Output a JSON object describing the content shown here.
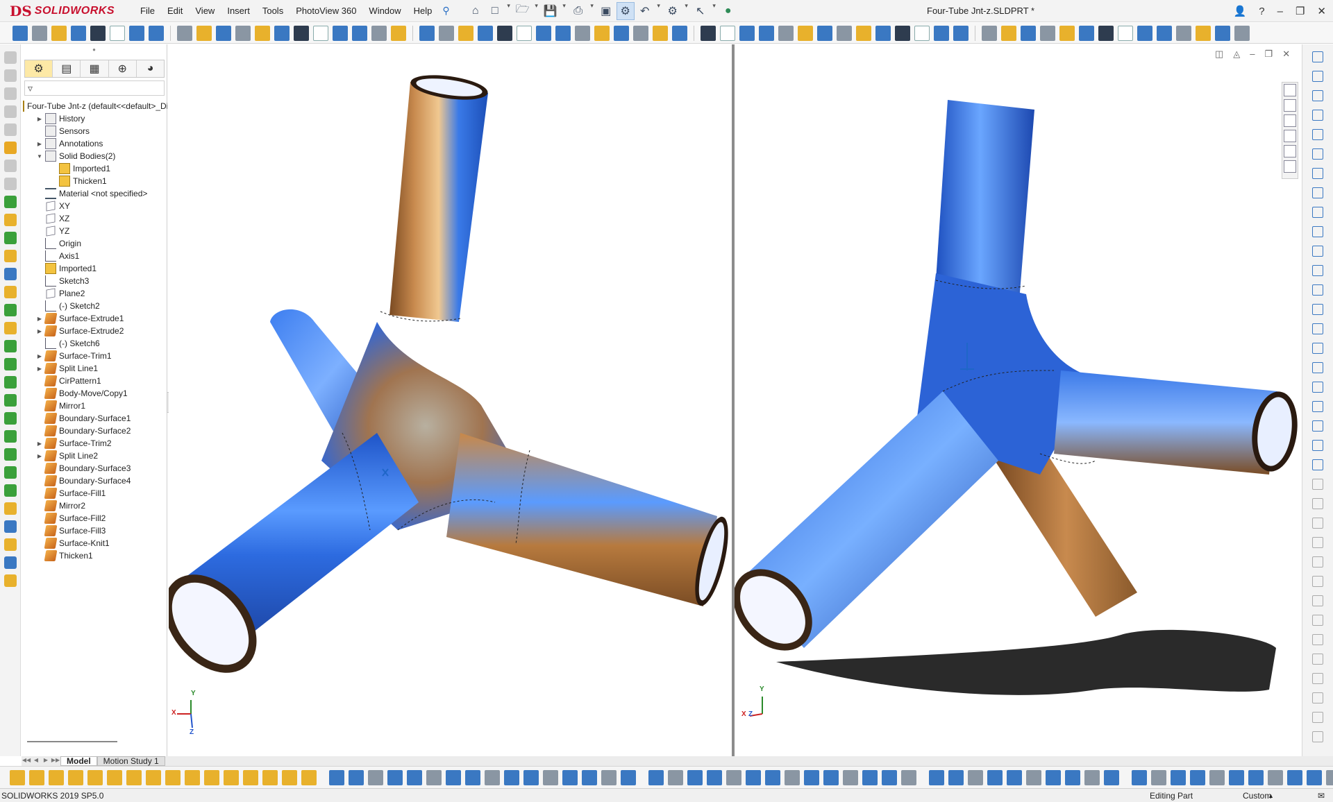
{
  "app": {
    "brand_mark": "DS",
    "brand_name": "SOLIDWORKS",
    "document_title": "Four-Tube Jnt-z.SLDPRT *"
  },
  "menu": [
    "File",
    "Edit",
    "View",
    "Insert",
    "Tools",
    "PhotoView 360",
    "Window",
    "Help"
  ],
  "window_controls": [
    "user-icon",
    "help-icon",
    "minimize-icon",
    "restore-icon",
    "close-icon"
  ],
  "feature_tree": {
    "panel_tabs": [
      "feature-manager-icon",
      "property-manager-icon",
      "configuration-manager-icon",
      "dimxpert-icon",
      "display-manager-icon"
    ],
    "nodes": [
      {
        "label": "Four-Tube Jnt-z  (default<<default>_Dis",
        "icon": "part-icon",
        "expandable": false,
        "indent": 0
      },
      {
        "label": "History",
        "icon": "folder-icon",
        "expandable": true,
        "indent": 1
      },
      {
        "label": "Sensors",
        "icon": "sensor-icon",
        "expandable": false,
        "indent": 1
      },
      {
        "label": "Annotations",
        "icon": "annotation-icon",
        "expandable": true,
        "indent": 1
      },
      {
        "label": "Solid Bodies(2)",
        "icon": "folder-icon",
        "expandable": true,
        "expanded": true,
        "indent": 1
      },
      {
        "label": "Imported1",
        "icon": "solid-body-icon",
        "expandable": false,
        "indent": 2
      },
      {
        "label": "Thicken1",
        "icon": "solid-body-icon",
        "expandable": false,
        "indent": 2
      },
      {
        "label": "Material <not specified>",
        "icon": "material-icon",
        "expandable": false,
        "indent": 1
      },
      {
        "label": "XY",
        "icon": "plane-icon",
        "expandable": false,
        "indent": 1
      },
      {
        "label": "XZ",
        "icon": "plane-icon",
        "expandable": false,
        "indent": 1
      },
      {
        "label": "YZ",
        "icon": "plane-icon",
        "expandable": false,
        "indent": 1
      },
      {
        "label": "Origin",
        "icon": "origin-icon",
        "expandable": false,
        "indent": 1
      },
      {
        "label": "Axis1",
        "icon": "axis-icon",
        "expandable": false,
        "indent": 1
      },
      {
        "label": "Imported1",
        "icon": "imported-feature-icon",
        "expandable": false,
        "indent": 1
      },
      {
        "label": "Sketch3",
        "icon": "sketch-icon",
        "expandable": false,
        "indent": 1
      },
      {
        "label": "Plane2",
        "icon": "plane-icon",
        "expandable": false,
        "indent": 1
      },
      {
        "label": "(-) Sketch2",
        "icon": "sketch-icon",
        "expandable": false,
        "indent": 1
      },
      {
        "label": "Surface-Extrude1",
        "icon": "surface-feature-icon",
        "expandable": true,
        "indent": 1
      },
      {
        "label": "Surface-Extrude2",
        "icon": "surface-feature-icon",
        "expandable": true,
        "indent": 1
      },
      {
        "label": "(-) Sketch6",
        "icon": "sketch-icon",
        "expandable": false,
        "indent": 1
      },
      {
        "label": "Surface-Trim1",
        "icon": "surface-feature-icon",
        "expandable": true,
        "indent": 1
      },
      {
        "label": "Split Line1",
        "icon": "split-line-icon",
        "expandable": true,
        "indent": 1
      },
      {
        "label": "CirPattern1",
        "icon": "pattern-icon",
        "expandable": false,
        "indent": 1
      },
      {
        "label": "Body-Move/Copy1",
        "icon": "move-body-icon",
        "expandable": false,
        "indent": 1
      },
      {
        "label": "Mirror1",
        "icon": "mirror-icon",
        "expandable": false,
        "indent": 1
      },
      {
        "label": "Boundary-Surface1",
        "icon": "surface-feature-icon",
        "expandable": false,
        "indent": 1
      },
      {
        "label": "Boundary-Surface2",
        "icon": "surface-feature-icon",
        "expandable": false,
        "indent": 1
      },
      {
        "label": "Surface-Trim2",
        "icon": "surface-feature-icon",
        "expandable": true,
        "indent": 1
      },
      {
        "label": "Split Line2",
        "icon": "split-line-icon",
        "expandable": true,
        "indent": 1
      },
      {
        "label": "Boundary-Surface3",
        "icon": "surface-feature-icon",
        "expandable": false,
        "indent": 1
      },
      {
        "label": "Boundary-Surface4",
        "icon": "surface-feature-icon",
        "expandable": false,
        "indent": 1
      },
      {
        "label": "Surface-Fill1",
        "icon": "surface-feature-icon",
        "expandable": false,
        "indent": 1
      },
      {
        "label": "Mirror2",
        "icon": "mirror-icon",
        "expandable": false,
        "indent": 1
      },
      {
        "label": "Surface-Fill2",
        "icon": "surface-feature-icon",
        "expandable": false,
        "indent": 1
      },
      {
        "label": "Surface-Fill3",
        "icon": "surface-feature-icon",
        "expandable": false,
        "indent": 1
      },
      {
        "label": "Surface-Knit1",
        "icon": "surface-feature-icon",
        "expandable": false,
        "indent": 1
      },
      {
        "label": "Thicken1",
        "icon": "thicken-icon",
        "expandable": false,
        "indent": 1
      }
    ]
  },
  "bottom_tabs": [
    {
      "label": "Model",
      "active": true
    },
    {
      "label": "Motion Study 1",
      "active": false
    }
  ],
  "status_bar": {
    "version": "SOLIDWORKS 2019 SP5.0",
    "mode": "Editing Part",
    "units": "Custom"
  },
  "viewports": {
    "left": {
      "triad": {
        "y": "Y",
        "x": "X",
        "z": "Z"
      }
    },
    "right": {
      "triad": {
        "y": "Y",
        "x": "X",
        "z": "Z"
      }
    }
  },
  "colors": {
    "tube_blue": "#2f6fe6",
    "tube_bronze": "#b0703a",
    "brand_red": "#c8102e",
    "selection_blue": "#1f66c8"
  }
}
